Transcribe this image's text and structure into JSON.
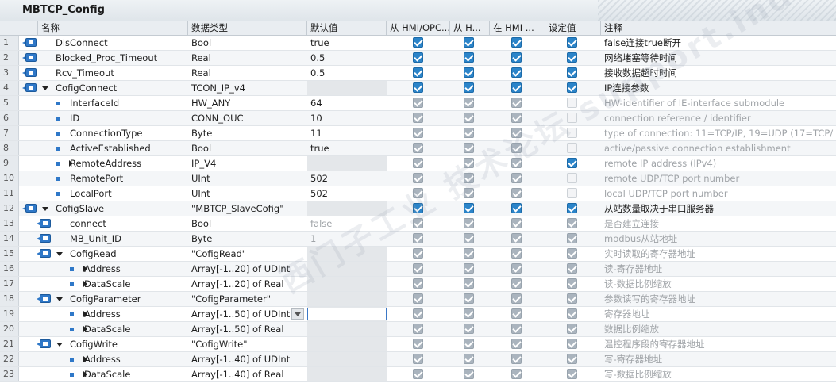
{
  "block": {
    "title": "MBTCP_Config"
  },
  "columns": {
    "name": "名称",
    "datatype": "数据类型",
    "default": "默认值",
    "hmi_opc": "从 HMI/OPC...",
    "hmi_h": "从 H...",
    "in_hmi": "在 HMI ...",
    "setpoint": "设定值",
    "comment": "注释"
  },
  "rows": [
    {
      "num": "1",
      "name": "DisConnect",
      "type": "Bool",
      "default": "true",
      "hmi_opc": "on",
      "hmi_h": "on",
      "in_hmi": "on",
      "setpoint": "on",
      "comment": "false连接true断开"
    },
    {
      "num": "2",
      "name": "Blocked_Proc_Timeout",
      "type": "Real",
      "default": "0.5",
      "hmi_opc": "on",
      "hmi_h": "on",
      "in_hmi": "on",
      "setpoint": "on",
      "comment": "网络堵塞等待时间"
    },
    {
      "num": "3",
      "name": "Rcv_Timeout",
      "type": "Real",
      "default": "0.5",
      "hmi_opc": "on",
      "hmi_h": "on",
      "in_hmi": "on",
      "setpoint": "on",
      "comment": "接收数据超时时间"
    },
    {
      "num": "4",
      "name": "CofigConnect",
      "type": "TCON_IP_v4",
      "default": "",
      "hmi_opc": "on",
      "hmi_h": "on",
      "in_hmi": "on",
      "setpoint": "on",
      "comment": "IP连接参数"
    },
    {
      "num": "5",
      "name": "InterfaceId",
      "type": "HW_ANY",
      "default": "64",
      "hmi_opc": "dim",
      "hmi_h": "dim",
      "in_hmi": "dim",
      "setpoint": "off",
      "comment": "HW-identifier of IE-interface submodule"
    },
    {
      "num": "6",
      "name": "ID",
      "type": "CONN_OUC",
      "default": "10",
      "hmi_opc": "dim",
      "hmi_h": "dim",
      "in_hmi": "dim",
      "setpoint": "off",
      "comment": "connection reference / identifier"
    },
    {
      "num": "7",
      "name": "ConnectionType",
      "type": "Byte",
      "default": "11",
      "hmi_opc": "dim",
      "hmi_h": "dim",
      "in_hmi": "dim",
      "setpoint": "off",
      "comment": "type of connection: 11=TCP/IP, 19=UDP (17=TCP/IP)"
    },
    {
      "num": "8",
      "name": "ActiveEstablished",
      "type": "Bool",
      "default": "true",
      "hmi_opc": "dim",
      "hmi_h": "dim",
      "in_hmi": "dim",
      "setpoint": "off",
      "comment": "active/passive connection establishment"
    },
    {
      "num": "9",
      "name": "RemoteAddress",
      "type": "IP_V4",
      "default": "",
      "hmi_opc": "dim",
      "hmi_h": "dim",
      "in_hmi": "dim",
      "setpoint": "on",
      "comment": "remote IP address (IPv4)"
    },
    {
      "num": "10",
      "name": "RemotePort",
      "type": "UInt",
      "default": "502",
      "hmi_opc": "dim",
      "hmi_h": "dim",
      "in_hmi": "dim",
      "setpoint": "off",
      "comment": "remote UDP/TCP port number"
    },
    {
      "num": "11",
      "name": "LocalPort",
      "type": "UInt",
      "default": "502",
      "hmi_opc": "dim",
      "hmi_h": "dim",
      "in_hmi": "dim",
      "setpoint": "off",
      "comment": "local UDP/TCP port number"
    },
    {
      "num": "12",
      "name": "CofigSlave",
      "type": "\"MBTCP_SlaveCofig\"",
      "default": "",
      "hmi_opc": "on",
      "hmi_h": "on",
      "in_hmi": "on",
      "setpoint": "on",
      "comment": "从站数量取决于串口服务器"
    },
    {
      "num": "13",
      "name": "connect",
      "type": "Bool",
      "default": "false",
      "hmi_opc": "dim",
      "hmi_h": "dim",
      "in_hmi": "dim",
      "setpoint": "dim",
      "comment": "是否建立连接"
    },
    {
      "num": "14",
      "name": "MB_Unit_ID",
      "type": "Byte",
      "default": "1",
      "hmi_opc": "dim",
      "hmi_h": "dim",
      "in_hmi": "dim",
      "setpoint": "dim",
      "comment": "modbus从站地址"
    },
    {
      "num": "15",
      "name": "CofigRead",
      "type": "\"CofigRead\"",
      "default": "",
      "hmi_opc": "dim",
      "hmi_h": "dim",
      "in_hmi": "dim",
      "setpoint": "dim",
      "comment": "实时读取的寄存器地址"
    },
    {
      "num": "16",
      "name": "Address",
      "type": "Array[-1..20] of UDInt",
      "default": "",
      "hmi_opc": "dim",
      "hmi_h": "dim",
      "in_hmi": "dim",
      "setpoint": "dim",
      "comment": "读-寄存器地址"
    },
    {
      "num": "17",
      "name": "DataScale",
      "type": "Array[-1..20] of Real",
      "default": "",
      "hmi_opc": "dim",
      "hmi_h": "dim",
      "in_hmi": "dim",
      "setpoint": "dim",
      "comment": "读-数据比例缩放"
    },
    {
      "num": "18",
      "name": "CofigParameter",
      "type": "\"CofigParameter\"",
      "default": "",
      "hmi_opc": "dim",
      "hmi_h": "dim",
      "in_hmi": "dim",
      "setpoint": "dim",
      "comment": "参数读写的寄存器地址"
    },
    {
      "num": "19",
      "name": "Address",
      "type": "Array[-1..50] of UDInt",
      "default": "",
      "hmi_opc": "dim",
      "hmi_h": "dim",
      "in_hmi": "dim",
      "setpoint": "dim",
      "comment": "寄存器地址"
    },
    {
      "num": "20",
      "name": "DataScale",
      "type": "Array[-1..50] of Real",
      "default": "",
      "hmi_opc": "dim",
      "hmi_h": "dim",
      "in_hmi": "dim",
      "setpoint": "dim",
      "comment": "数据比例缩放"
    },
    {
      "num": "21",
      "name": "CofigWrite",
      "type": "\"CofigWrite\"",
      "default": "",
      "hmi_opc": "dim",
      "hmi_h": "dim",
      "in_hmi": "dim",
      "setpoint": "dim",
      "comment": "温控程序段的寄存器地址"
    },
    {
      "num": "22",
      "name": "Address",
      "type": "Array[-1..40] of UDInt",
      "default": "",
      "hmi_opc": "dim",
      "hmi_h": "dim",
      "in_hmi": "dim",
      "setpoint": "dim",
      "comment": "写-寄存器地址"
    },
    {
      "num": "23",
      "name": "DataScale",
      "type": "Array[-1..40] of Real",
      "default": "",
      "hmi_opc": "dim",
      "hmi_h": "dim",
      "in_hmi": "dim",
      "setpoint": "dim",
      "comment": "写-数据比例缩放"
    }
  ],
  "colors": {
    "accent": "#2b84c9",
    "dim_check": "#aab4be",
    "header_bg": "#e9edf1"
  },
  "watermark": "西门子工业 技术论坛 support.industry.siemens.com/cs"
}
